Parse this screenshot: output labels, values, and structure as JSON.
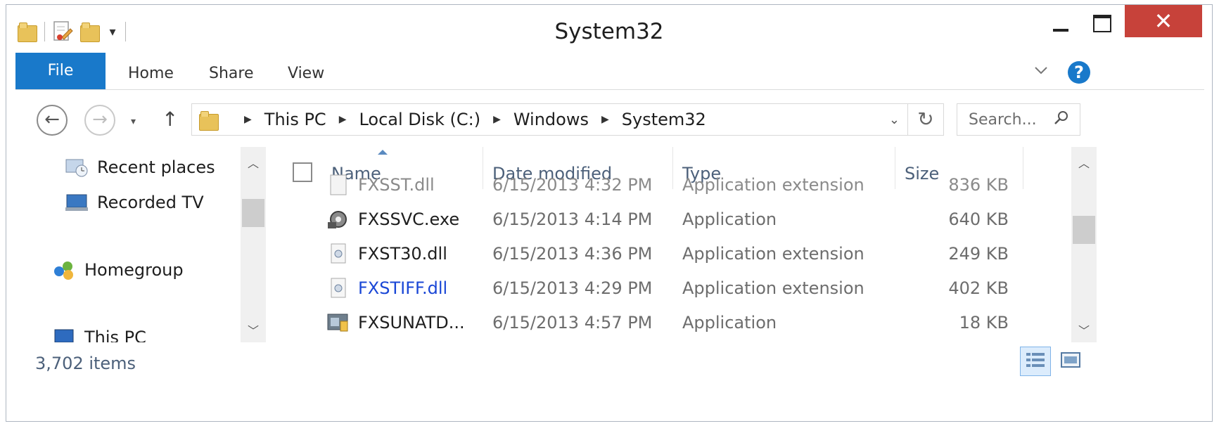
{
  "window": {
    "title": "System32"
  },
  "controls": {
    "close_label": "✕"
  },
  "ribbon": {
    "file_label": "File",
    "tabs": [
      "Home",
      "Share",
      "View"
    ],
    "help_label": "?"
  },
  "nav": {
    "back_label": "←",
    "forward_label": "→",
    "up_label": "↑",
    "recent_label": "▾"
  },
  "address": {
    "crumbs": [
      "This PC",
      "Local Disk (C:)",
      "Windows",
      "System32"
    ],
    "separator": "▶"
  },
  "search": {
    "placeholder": "Search...",
    "icon": "search-icon"
  },
  "navpane": {
    "items": [
      {
        "label": "Recent places",
        "icon": "recent-places-icon"
      },
      {
        "label": "Recorded TV",
        "icon": "recorded-tv-icon"
      },
      {
        "label": "Homegroup",
        "icon": "homegroup-icon"
      },
      {
        "label": "This PC",
        "icon": "this-pc-icon"
      }
    ]
  },
  "columns": {
    "name": "Name",
    "date": "Date modified",
    "type": "Type",
    "size": "Size"
  },
  "files": [
    {
      "name": "FXSST.dll",
      "date": "6/15/2013 4:32 PM",
      "type": "Application extension",
      "size": "836 KB",
      "icon": "dll-icon"
    },
    {
      "name": "FXSSVC.exe",
      "date": "6/15/2013 4:14 PM",
      "type": "Application",
      "size": "640 KB",
      "icon": "fax-service-icon"
    },
    {
      "name": "FXST30.dll",
      "date": "6/15/2013 4:36 PM",
      "type": "Application extension",
      "size": "249 KB",
      "icon": "dll-icon"
    },
    {
      "name": "FXSTIFF.dll",
      "date": "6/15/2013 4:29 PM",
      "type": "Application extension",
      "size": "402 KB",
      "icon": "dll-icon"
    },
    {
      "name": "FXSUNATD...",
      "date": "6/15/2013 4:57 PM",
      "type": "Application",
      "size": "18 KB",
      "icon": "exe-icon"
    }
  ],
  "status": {
    "item_count": "3,702 items"
  },
  "colors": {
    "file_tab": "#1979ca",
    "close_button": "#c7423a",
    "header_text": "#4c607a",
    "link_text": "#1a47d6"
  }
}
